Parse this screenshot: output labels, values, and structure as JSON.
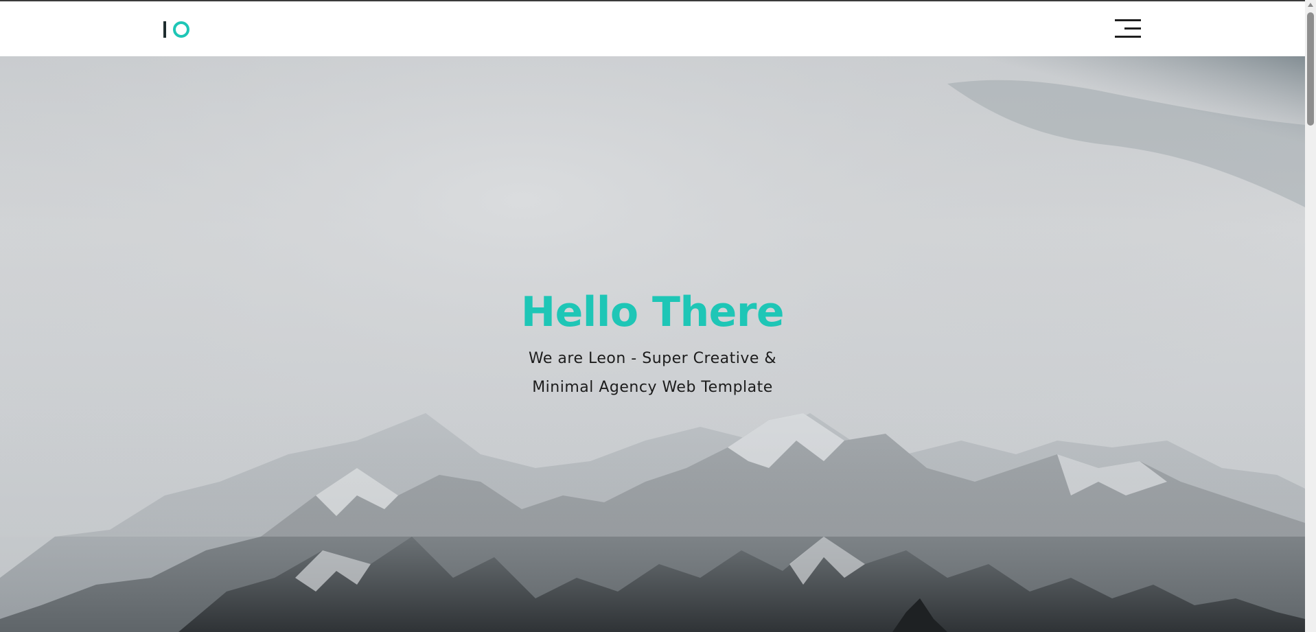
{
  "header": {
    "logo_icon": "io-logo",
    "menu_icon": "hamburger-menu-icon"
  },
  "hero": {
    "title": "Hello There",
    "subtitle_line1": "We are Leon - Super Creative &",
    "subtitle_line2": "Minimal Agency Web Template",
    "background": "foggy snowy mountain range photo"
  },
  "colors": {
    "accent": "#1ec6b6",
    "text_dark": "#1c1c1c",
    "header_bg": "#ffffff"
  }
}
